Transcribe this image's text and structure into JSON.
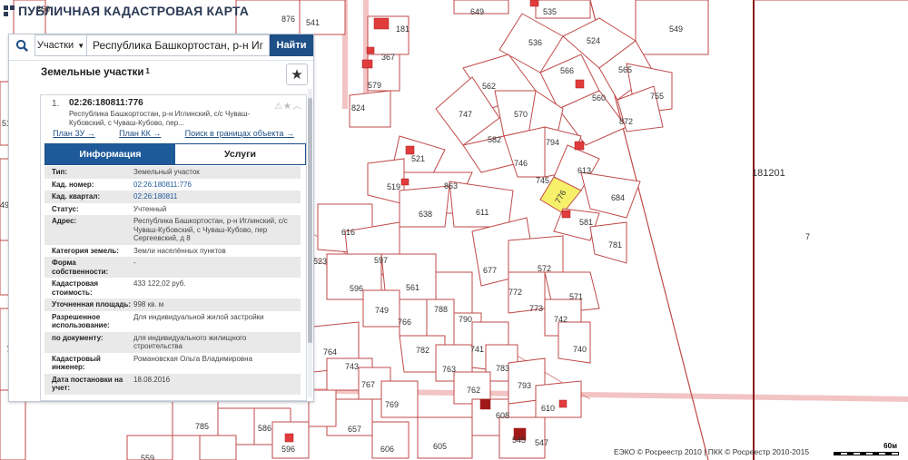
{
  "app": {
    "title": "ПУБЛИЧНАЯ КАДАСТРОВАЯ КАРТА"
  },
  "search": {
    "mode": "Участки",
    "value": "Республика Башкортостан, р-н Иглинский, с/с Чуваш-Кубовский",
    "button": "Найти"
  },
  "panel": {
    "title": "Земельные участки",
    "count": "1"
  },
  "object": {
    "index": "1.",
    "cad_number": "02:26:180811:776",
    "address": "Республика Башкортостан, р-н Иглинский, с/с Чуваш-Кубовский, с Чуваш-Кубово, пер...",
    "links": [
      "План ЗУ →",
      "План КК →",
      "Поиск в границах объекта →"
    ],
    "tabs": {
      "info": "Информация",
      "services": "Услуги"
    },
    "rows": [
      {
        "k": "Тип:",
        "v": "Земельный участок"
      },
      {
        "k": "Кад. номер:",
        "v": "02:26:180811:776",
        "link": true
      },
      {
        "k": "Кад. квартал:",
        "v": "02:26:180811",
        "link": true
      },
      {
        "k": "Статус:",
        "v": "Учтенный"
      },
      {
        "k": "Адрес:",
        "v": "Республика Башкортостан, р-н Иглинский, с/с Чуваш-Кубовский, с Чуваш-Кубово, пер Сергеевский, д 8"
      },
      {
        "k": "Категория земель:",
        "v": "Земли населённых пунктов"
      },
      {
        "k": "Форма собственности:",
        "v": "-"
      },
      {
        "k": "Кадастровая стоимость:",
        "v": "433 122,02 руб."
      },
      {
        "k": "Уточненная площадь:",
        "v": "998 кв. м"
      },
      {
        "k": "Разрешенное использование:",
        "v": "Для индивидуальной жилой застройки"
      },
      {
        "k": "по документу:",
        "v": "для индивидуального жилищного строительства"
      },
      {
        "k": "Кадастровый инженер:",
        "v": "Романовская Ольга Владимировна"
      },
      {
        "k": "Дата постановки на учет:",
        "v": "18.08.2016"
      }
    ]
  },
  "map": {
    "labels": [
      "860",
      "876",
      "541",
      "649",
      "535",
      "549",
      "526",
      "181",
      "367",
      "536",
      "524",
      "566",
      "565",
      "511",
      "579",
      "560",
      "755",
      "824",
      "562",
      "747",
      "570",
      "872",
      "794",
      "582",
      "746",
      "613",
      "521",
      "745",
      "776",
      "684",
      "519",
      "863",
      "181201",
      "638",
      "611",
      "581",
      "616",
      "781",
      "597",
      "499",
      "677",
      "572",
      "526",
      "523",
      "596",
      "561",
      "772",
      "773",
      "571",
      "749",
      "788",
      "742",
      "740",
      "766",
      "790",
      "782",
      "741",
      "764",
      "758",
      "763",
      "783",
      "743",
      "767",
      "762",
      "793",
      "769",
      "610",
      "657",
      "608",
      "785",
      "586",
      "606",
      "605",
      "596",
      "545",
      "547",
      "559",
      "7"
    ],
    "selected": "776"
  },
  "footer": {
    "attribution": "ЕЭКО © Росреестр 2010 | ПКК © Росреестр 2010-2015",
    "scale": "60м"
  }
}
